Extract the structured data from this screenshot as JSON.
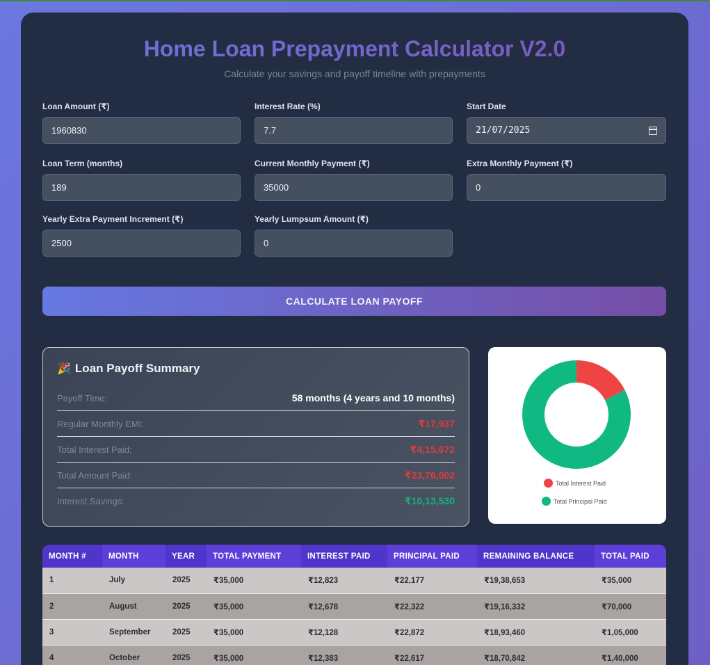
{
  "header": {
    "title": "Home Loan Prepayment Calculator V2.0",
    "subtitle": "Calculate your savings and payoff timeline with prepayments"
  },
  "form": {
    "loan_amount": {
      "label": "Loan Amount (₹)",
      "value": "1960830"
    },
    "interest_rate": {
      "label": "Interest Rate (%)",
      "value": "7.7"
    },
    "start_date": {
      "label": "Start Date",
      "value": "21/07/2025"
    },
    "loan_term": {
      "label": "Loan Term (months)",
      "value": "189"
    },
    "current_monthly_payment": {
      "label": "Current Monthly Payment (₹)",
      "value": "35000"
    },
    "extra_monthly_payment": {
      "label": "Extra Monthly Payment (₹)",
      "value": "0"
    },
    "yearly_extra_increment": {
      "label": "Yearly Extra Payment Increment (₹)",
      "value": "2500"
    },
    "yearly_lumpsum": {
      "label": "Yearly Lumpsum Amount (₹)",
      "value": "0"
    }
  },
  "calculate_button": "CALCULATE LOAN PAYOFF",
  "summary": {
    "icon": "party-popper",
    "title": "Loan Payoff Summary",
    "rows": [
      {
        "label": "Payoff Time:",
        "value": "58 months (4 years and 10 months)"
      },
      {
        "label": "Regular Monthly EMI:",
        "value": "₹17,937"
      },
      {
        "label": "Total Interest Paid:",
        "value": "₹4,15,672"
      },
      {
        "label": "Total Amount Paid:",
        "value": "₹23,76,502"
      },
      {
        "label": "Interest Savings:",
        "value": "₹10,13,530"
      }
    ]
  },
  "colors": {
    "interest": "#ef4444",
    "principal": "#10b981",
    "accent": "#6679e2"
  },
  "chart_data": {
    "type": "pie",
    "labels": [
      "Total Interest Paid",
      "Total Principal Paid"
    ],
    "values": [
      415672,
      1960830
    ],
    "donut": true,
    "legend": "bottom"
  },
  "table": {
    "headers": [
      "MONTH #",
      "MONTH",
      "YEAR",
      "TOTAL PAYMENT",
      "INTEREST PAID",
      "PRINCIPAL PAID",
      "REMAINING BALANCE",
      "TOTAL PAID"
    ],
    "rows": [
      [
        "1",
        "July",
        "2025",
        "₹35,000",
        "₹12,823",
        "₹22,177",
        "₹19,38,653",
        "₹35,000"
      ],
      [
        "2",
        "August",
        "2025",
        "₹35,000",
        "₹12,678",
        "₹22,322",
        "₹19,16,332",
        "₹70,000"
      ],
      [
        "3",
        "September",
        "2025",
        "₹35,000",
        "₹12,128",
        "₹22,872",
        "₹18,93,460",
        "₹1,05,000"
      ],
      [
        "4",
        "October",
        "2025",
        "₹35,000",
        "₹12,383",
        "₹22,617",
        "₹18,70,842",
        "₹1,40,000"
      ]
    ]
  }
}
